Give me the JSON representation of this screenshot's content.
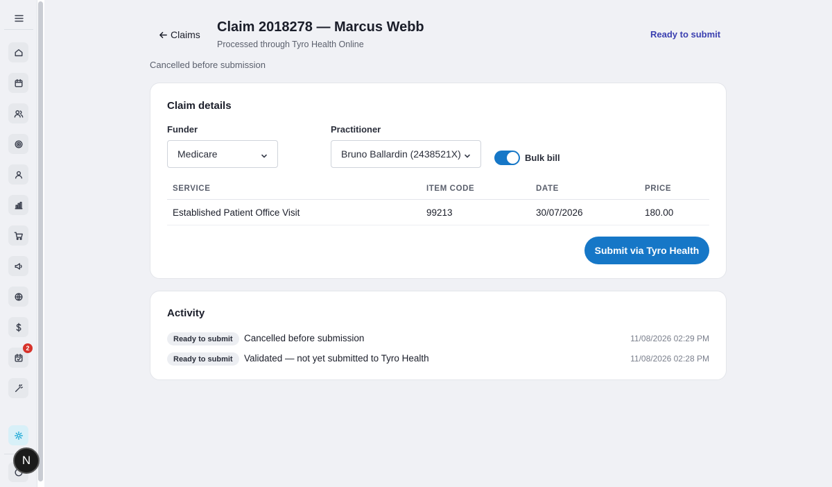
{
  "sidebar": {
    "items": [
      {
        "name": "home-icon"
      },
      {
        "name": "calendar-icon"
      },
      {
        "name": "users-icon"
      },
      {
        "name": "target-icon"
      },
      {
        "name": "user-icon"
      },
      {
        "name": "bar-chart-icon"
      },
      {
        "name": "cart-icon"
      },
      {
        "name": "megaphone-icon"
      },
      {
        "name": "globe-icon"
      },
      {
        "name": "dollar-icon"
      },
      {
        "name": "calendar-check-icon",
        "badge": "2"
      },
      {
        "name": "magic-wand-icon"
      },
      {
        "name": "settings-sun-icon",
        "active": true
      }
    ],
    "avatar_letter": "N"
  },
  "header": {
    "back_label": "Claims",
    "title": "Claim 2018278 — Marcus Webb",
    "subtitle": "Processed through Tyro Health Online",
    "status": "Ready to submit",
    "status_note": "Cancelled before submission"
  },
  "claim": {
    "title": "Claim details",
    "funder_label": "Funder",
    "funder_value": "Medicare",
    "practitioner_label": "Practitioner",
    "practitioner_value": "Bruno Ballardin (2438521X)",
    "bulk_bill_label": "Bulk bill",
    "bulk_bill_on": true,
    "table": {
      "columns": [
        "SERVICE",
        "ITEM CODE",
        "DATE",
        "PRICE"
      ],
      "rows": [
        {
          "service": "Established Patient Office Visit",
          "item_code": "99213",
          "date": "30/07/2026",
          "price": "180.00"
        }
      ]
    },
    "submit_label": "Submit via Tyro Health"
  },
  "activity": {
    "title": "Activity",
    "entries": [
      {
        "status": "Ready to submit",
        "text": "Cancelled before submission",
        "time": "11/08/2026 02:29 PM"
      },
      {
        "status": "Ready to submit",
        "text": "Validated — not yet submitted to Tyro Health",
        "time": "11/08/2026 02:28 PM"
      }
    ]
  },
  "colors": {
    "accent": "#1677c7",
    "status_text": "#3a3fb0",
    "badge": "#d7332b"
  }
}
